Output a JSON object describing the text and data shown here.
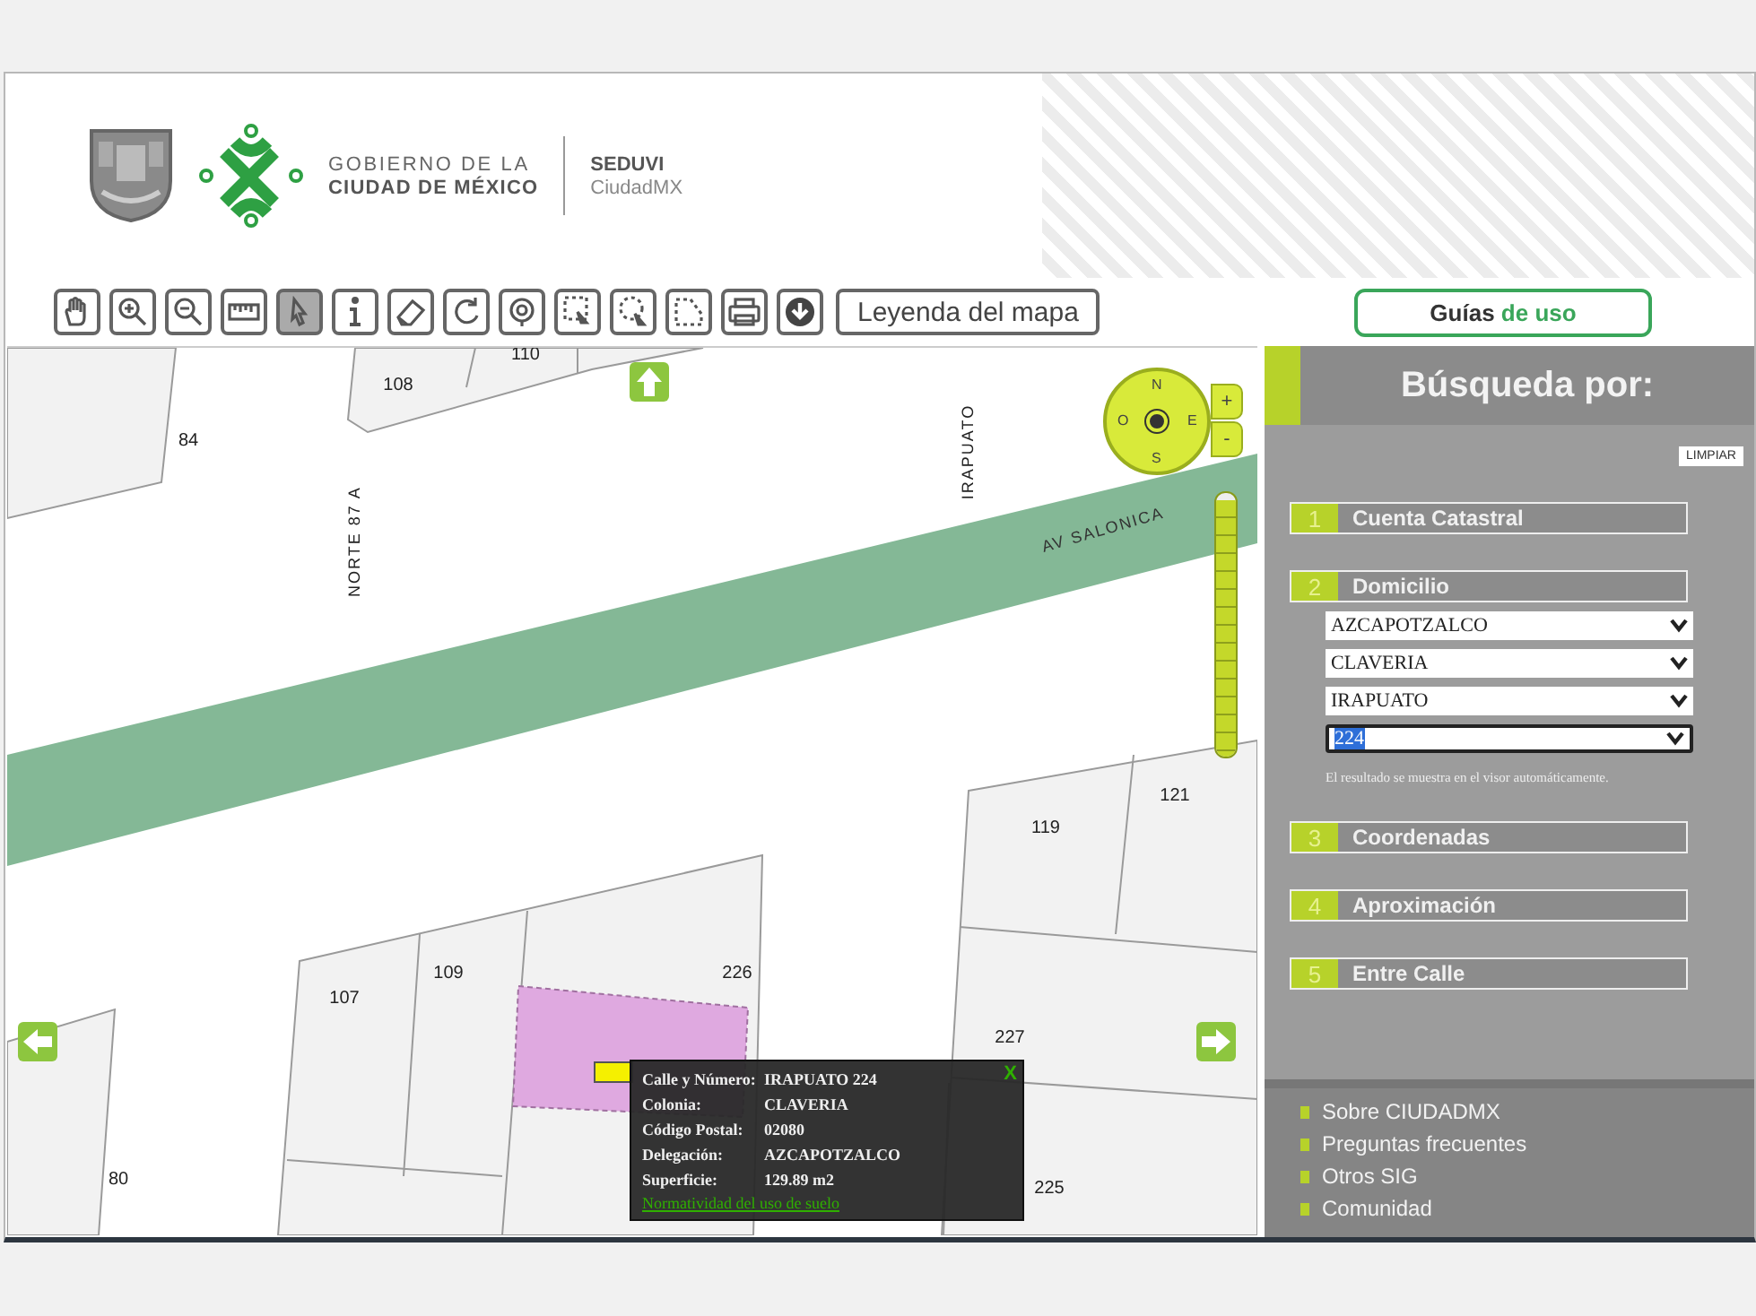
{
  "header": {
    "government_line1": "GOBIERNO DE LA",
    "government_line2": "CIUDAD DE MÉXICO",
    "agency": "SEDUVI",
    "agency_sub": "CiudadMX"
  },
  "toolbar": {
    "tools": [
      {
        "kind": "pan",
        "selected": false
      },
      {
        "kind": "zoom-in",
        "selected": false
      },
      {
        "kind": "zoom-out",
        "selected": false
      },
      {
        "kind": "ruler",
        "selected": false
      },
      {
        "kind": "pointer",
        "selected": true
      },
      {
        "kind": "info",
        "selected": false
      },
      {
        "kind": "eraser",
        "selected": false
      },
      {
        "kind": "refresh",
        "selected": false
      },
      {
        "kind": "circle",
        "selected": false
      },
      {
        "kind": "rect-select",
        "selected": false
      },
      {
        "kind": "circle-select",
        "selected": false
      },
      {
        "kind": "polygon-select",
        "selected": false
      },
      {
        "kind": "print",
        "selected": false
      },
      {
        "kind": "download",
        "selected": false
      }
    ],
    "legend_button": "Leyenda del mapa"
  },
  "guides_button": {
    "text": "Guías",
    "accent": "de uso"
  },
  "map": {
    "labels": [
      {
        "kind": "lot",
        "text": "84"
      },
      {
        "kind": "lot",
        "text": "108"
      },
      {
        "kind": "lot",
        "text": "110"
      },
      {
        "kind": "street",
        "text": "NORTE 87 A"
      },
      {
        "kind": "street",
        "text": "IRAPUATO"
      },
      {
        "kind": "avenue",
        "text": "AV SALONICA"
      },
      {
        "kind": "lot",
        "text": "119"
      },
      {
        "kind": "lot",
        "text": "121"
      },
      {
        "kind": "lot",
        "text": "107"
      },
      {
        "kind": "lot",
        "text": "109"
      },
      {
        "kind": "lot",
        "text": "226"
      },
      {
        "kind": "lot",
        "text": "227"
      },
      {
        "kind": "lot",
        "text": "80"
      },
      {
        "kind": "lot",
        "text": "225"
      }
    ],
    "compass": {
      "north": "N",
      "west": "O",
      "east": "E",
      "south": "S"
    },
    "zoom": {
      "plus": "+",
      "minus": "-",
      "level": 0.97
    },
    "popup": {
      "close": "X",
      "fields": [
        {
          "label": "Calle y Número:",
          "value": "IRAPUATO 224"
        },
        {
          "label": "Colonia:",
          "value": "CLAVERIA"
        },
        {
          "label": "Código Postal:",
          "value": "02080"
        },
        {
          "label": "Delegación:",
          "value": "AZCAPOTZALCO"
        },
        {
          "label": "Superficie:",
          "value": "129.89 m2"
        }
      ],
      "link": "Normatividad del uso de suelo"
    }
  },
  "search_panel": {
    "title": "Búsqueda por:",
    "clear_button": "LIMPIAR",
    "sections": [
      {
        "number": "1",
        "label": "Cuenta Catastral"
      },
      {
        "number": "2",
        "label": "Domicilio",
        "selects": [
          {
            "value": "AZCAPOTZALCO",
            "focused": false
          },
          {
            "value": "CLAVERIA",
            "focused": false
          },
          {
            "value": "IRAPUATO",
            "focused": false
          },
          {
            "value": "224",
            "focused": true
          }
        ],
        "note": "El resultado se muestra en el visor automáticamente."
      },
      {
        "number": "3",
        "label": "Coordenadas"
      },
      {
        "number": "4",
        "label": "Aproximación"
      },
      {
        "number": "5",
        "label": "Entre Calle"
      }
    ]
  },
  "footer_links": [
    "Sobre CIUDADMX",
    "Preguntas frecuentes",
    "Otros SIG",
    "Comunidad"
  ]
}
